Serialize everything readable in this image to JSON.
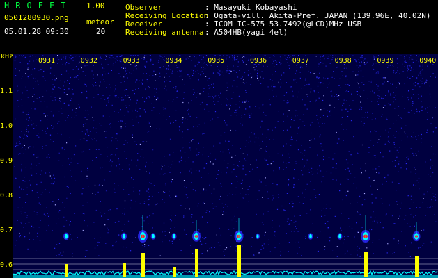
{
  "app": {
    "name": "HROFFT",
    "version": "1.00",
    "filename": "0501280930.png",
    "datetime": "05.01.28 09:30",
    "meteor_label": "meteor",
    "meteor_count": "20"
  },
  "info": [
    {
      "label": "Observer",
      "value": ": Masayuki Kobayashi"
    },
    {
      "label": "Receiving Location",
      "value": ": Ogata-vill. Akita-Pref. JAPAN (139.96E, 40.02N)"
    },
    {
      "label": "Receiver",
      "value": ": ICOM IC-575 53.7492(@LCD)MHz USB"
    },
    {
      "label": "Receiving antenna",
      "value": ": A504HB(yagi 4el)"
    }
  ],
  "spectrogram": {
    "y_unit": "kHz",
    "y_ticks": [
      "1.1",
      "1.0",
      "0.9",
      "0.8",
      "0.7",
      "0.6"
    ],
    "time_ticks": [
      "0931",
      "0932",
      "0933",
      "0934",
      "0935",
      "0936",
      "0937",
      "0938",
      "0939",
      "0940"
    ],
    "colors": {
      "background": "#000040",
      "noise": "#2a2aff",
      "signal_hot": "#ff2020",
      "signal_mid": "#00ffff",
      "level_trace": "#00ffff",
      "level_peak": "#ffff00",
      "axis_text": "#ffff00"
    }
  }
}
